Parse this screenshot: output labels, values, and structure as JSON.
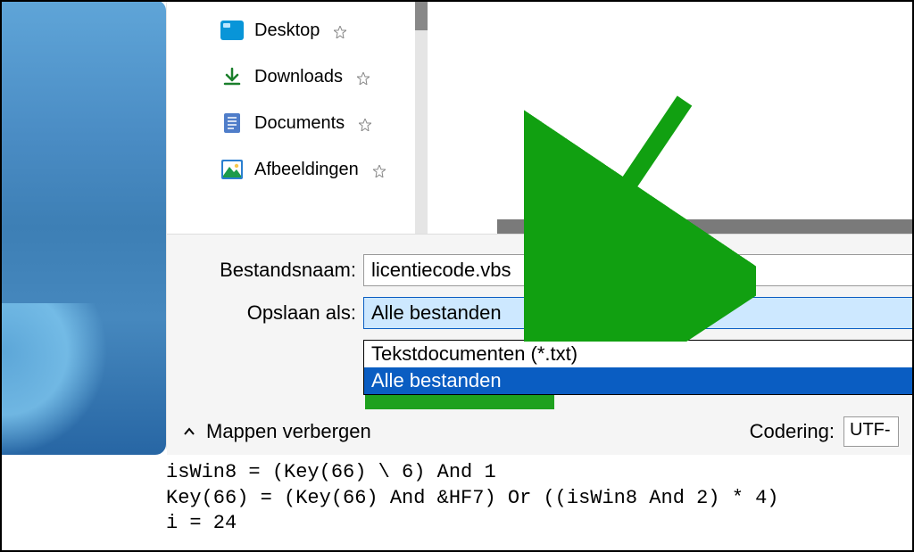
{
  "nav": {
    "items": [
      {
        "label": "Desktop",
        "icon": "desktop-icon"
      },
      {
        "label": "Downloads",
        "icon": "download-icon"
      },
      {
        "label": "Documents",
        "icon": "document-icon"
      },
      {
        "label": "Afbeeldingen",
        "icon": "image-icon"
      }
    ]
  },
  "form": {
    "filename_label": "Bestandsnaam:",
    "filename_value": "licentiecode.vbs",
    "saveas_label": "Opslaan als:",
    "saveas_selected": "Alle bestanden",
    "saveas_options": [
      "Tekstdocumenten (*.txt)",
      "Alle bestanden"
    ]
  },
  "footer": {
    "hide_folders": "Mappen verbergen",
    "encoding_label": "Codering:",
    "encoding_value": "UTF-"
  },
  "code": {
    "line1": "isWin8 = (Key(66) \\ 6) And 1",
    "line2": "Key(66) = (Key(66) And &HF7) Or ((isWin8 And 2) * 4)",
    "line3": "i = 24"
  }
}
